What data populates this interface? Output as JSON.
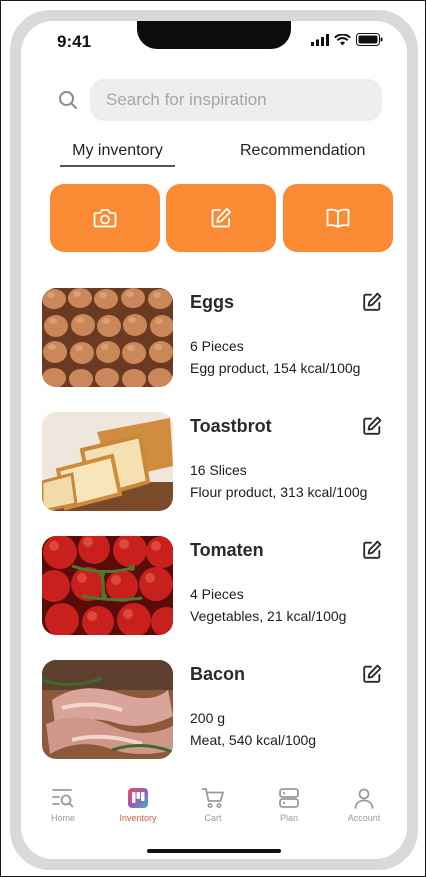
{
  "status_bar": {
    "time": "9:41"
  },
  "search": {
    "placeholder": "Search for inspiration"
  },
  "tabs": [
    {
      "label": "My inventory",
      "active": true
    },
    {
      "label": "Recommendation",
      "active": false
    }
  ],
  "actions": [
    {
      "icon": "camera-icon"
    },
    {
      "icon": "edit-icon"
    },
    {
      "icon": "book-icon"
    }
  ],
  "items": [
    {
      "name": "Eggs",
      "quantity": "6 Pieces",
      "info": "Egg product, 154 kcal/100g"
    },
    {
      "name": "Toastbrot",
      "quantity": "16 Slices",
      "info": "Flour product, 313 kcal/100g"
    },
    {
      "name": "Tomaten",
      "quantity": "4 Pieces",
      "info": "Vegetables, 21 kcal/100g"
    },
    {
      "name": "Bacon",
      "quantity": "200 g",
      "info": "Meat, 540 kcal/100g"
    }
  ],
  "nav": [
    {
      "label": "Home",
      "icon": "home-search-icon",
      "active": false
    },
    {
      "label": "Inventory",
      "icon": "inventory-icon",
      "active": true
    },
    {
      "label": "Cart",
      "icon": "cart-icon",
      "active": false
    },
    {
      "label": "Plan",
      "icon": "plan-icon",
      "active": false
    },
    {
      "label": "Account",
      "icon": "account-icon",
      "active": false
    }
  ],
  "colors": {
    "accent": "#fa8a34",
    "active_nav": "#e05a3c",
    "search_bg": "#eeeeee"
  }
}
